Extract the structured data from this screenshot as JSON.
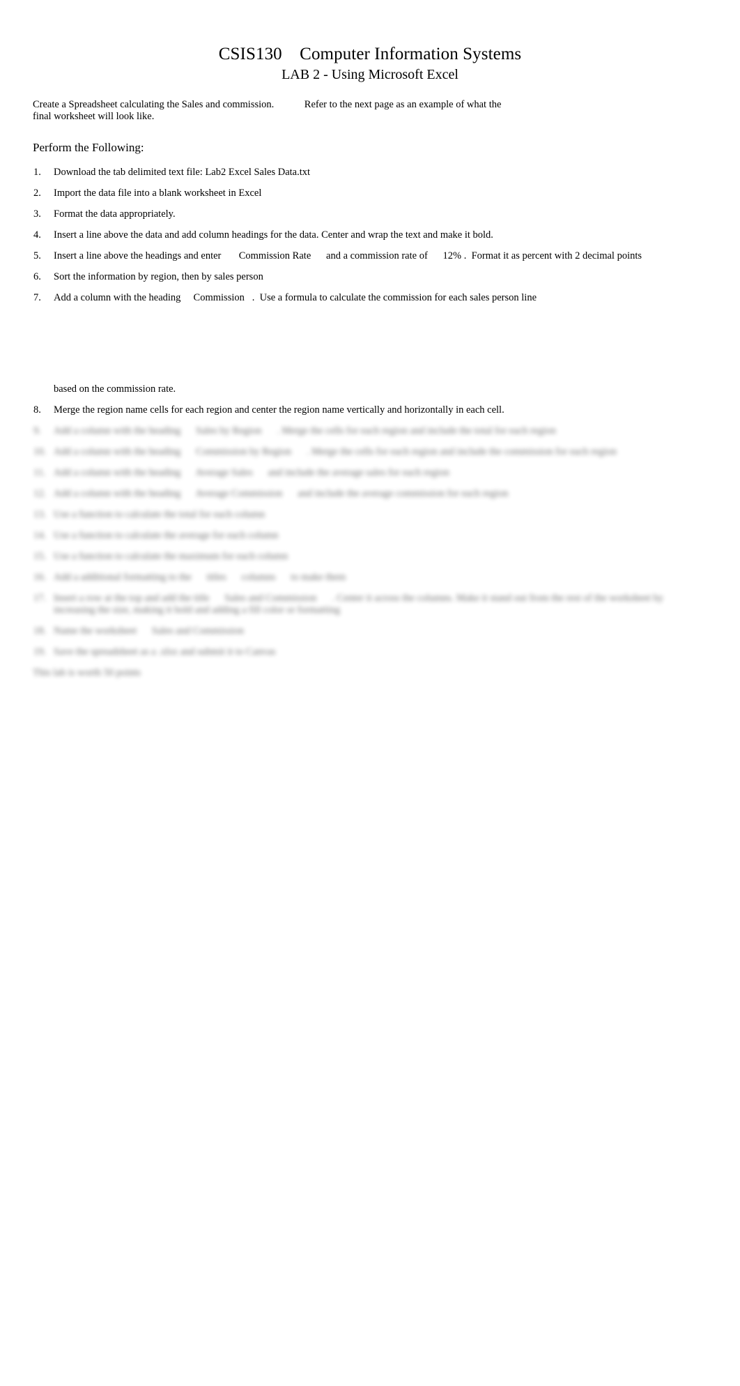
{
  "document": {
    "title_line_1": "CSIS130    Computer Information Systems",
    "title_line_2": "LAB 2 - Using Microsoft Excel",
    "intro": "Create a Spreadsheet calculating the Sales and commission.            Refer to the next page as an example of what the final worksheet will look like.",
    "section_heading": "Perform the Following:",
    "steps": [
      {
        "num": "1.",
        "text": "Download the tab delimited text file: Lab2 Excel Sales Data.txt"
      },
      {
        "num": "2.",
        "text": "Import the data file into a blank worksheet in Excel"
      },
      {
        "num": "3.",
        "text": "Format the data appropriately."
      },
      {
        "num": "4.",
        "text": "Insert a line above the data and add column headings for the data. Center and wrap the text and make it bold."
      },
      {
        "num": "5.",
        "text": "Insert a line above the headings and enter       Commission Rate      and a commission rate of      12% .  Format it as percent with 2 decimal points"
      },
      {
        "num": "6.",
        "text": "Sort the information by region, then by sales person"
      },
      {
        "num": "7.",
        "text": "Add a column with the heading     Commission   .  Use a formula to calculate the commission for each sales person line"
      }
    ],
    "continuation": "based on the commission rate.",
    "step_8": {
      "num": "8.",
      "text": "Merge the region name cells for each region and center the region name vertically and horizontally in each cell."
    },
    "blurred_steps": [
      {
        "num": "9.",
        "text": "Add a column with the heading      Sales by Region      . Merge the cells for each region and include the total for each region"
      },
      {
        "num": "10.",
        "text": "Add a column with the heading      Commission by Region      . Merge the cells for each region and include the commission for each region"
      },
      {
        "num": "11.",
        "text": "Add a column with the heading      Average Sales      and include the average sales for each region"
      },
      {
        "num": "12.",
        "text": "Add a column with the heading      Average Commission      and include the average commission for each region"
      },
      {
        "num": "13.",
        "text": "Use a function to calculate the total for each column"
      },
      {
        "num": "14.",
        "text": "Use a function to calculate the average for each column"
      },
      {
        "num": "15.",
        "text": "Use a function to calculate the maximum for each column"
      },
      {
        "num": "16.",
        "text": "Add a additional formatting to the      titles      columns      to make them"
      },
      {
        "num": "17.",
        "text": "Insert a row at the top and add the title      Sales and Commission      . Center it across the columns. Make it stand out from the rest of the worksheet by increasing the size, making it bold and adding a fill color or formatting"
      },
      {
        "num": "18.",
        "text": "Name the worksheet      Sales and Commission"
      },
      {
        "num": "19.",
        "text": "Save the spreadsheet as a .xlsx and submit it to Canvas"
      }
    ],
    "blurred_tail": "This lab is worth 50 points"
  }
}
